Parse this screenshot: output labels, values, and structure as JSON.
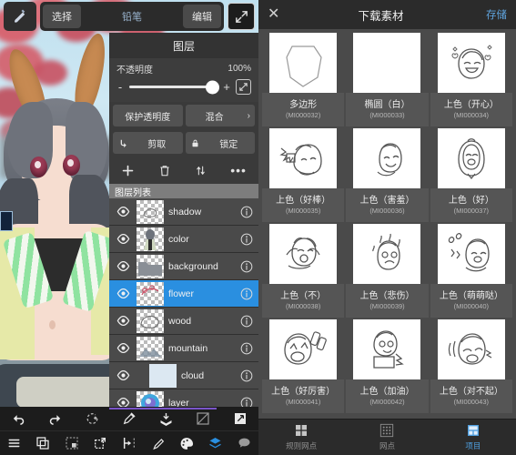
{
  "editor": {
    "toolbar": {
      "brush_icon": "brush-icon",
      "select_label": "选择",
      "tool_label": "铅笔",
      "edit_label": "编辑",
      "expand_icon": "expand-arrows-icon"
    },
    "layers_panel": {
      "title": "图层",
      "opacity_label": "不透明度",
      "opacity_value": "100%",
      "minus": "-",
      "plus": "+",
      "slider_icon": "expand-icon",
      "protect_alpha_label": "保护透明度",
      "blend_label": "混合",
      "blend_chevron": "›",
      "clip_label": "剪取",
      "clip_icon": "clip-arrow-icon",
      "lock_label": "锁定",
      "lock_icon": "lock-icon",
      "tools": [
        {
          "name": "add-layer-icon",
          "glyph": "+"
        },
        {
          "name": "delete-layer-icon",
          "glyph": "trash"
        },
        {
          "name": "reorder-layer-icon",
          "glyph": "arrows"
        },
        {
          "name": "more-options-icon",
          "glyph": "•••"
        }
      ],
      "list_header": "图层列表",
      "layers": [
        {
          "name": "shadow",
          "visible": true,
          "selected": false,
          "clipped": false
        },
        {
          "name": "color",
          "visible": true,
          "selected": false,
          "clipped": false
        },
        {
          "name": "background",
          "visible": true,
          "selected": false,
          "clipped": false
        },
        {
          "name": "flower",
          "visible": true,
          "selected": true,
          "clipped": false
        },
        {
          "name": "wood",
          "visible": true,
          "selected": false,
          "clipped": false
        },
        {
          "name": "mountain",
          "visible": true,
          "selected": false,
          "clipped": false
        },
        {
          "name": "cloud",
          "visible": true,
          "selected": false,
          "clipped": true
        },
        {
          "name": "layer",
          "visible": true,
          "selected": false,
          "clipped": false
        }
      ],
      "eye_icon": "eye-icon",
      "info_icon": "info-icon",
      "selection_color": "#2a8fe0"
    },
    "bottom_toolbar": {
      "row1": [
        {
          "name": "undo-icon"
        },
        {
          "name": "redo-icon"
        },
        {
          "name": "rotate-icon"
        },
        {
          "name": "eyedropper-icon"
        },
        {
          "name": "bucket-save-icon"
        },
        {
          "name": "gradient-icon"
        },
        {
          "name": "fill-square-icon"
        }
      ],
      "row2": [
        {
          "name": "menu-icon"
        },
        {
          "name": "copy-icon"
        },
        {
          "name": "select-region-icon"
        },
        {
          "name": "transform-icon"
        },
        {
          "name": "ruler-icon"
        },
        {
          "name": "pen-icon"
        },
        {
          "name": "palette-icon"
        },
        {
          "name": "layers-icon"
        },
        {
          "name": "speech-bubble-icon"
        }
      ]
    }
  },
  "materials": {
    "header": {
      "close_icon": "close-icon",
      "title": "下载素材",
      "save_label": "存储"
    },
    "items": [
      {
        "name": "多边形",
        "id": "(MI000032)",
        "art": "polygon"
      },
      {
        "name": "椭圆（白）",
        "id": "(MI000033)",
        "art": "blank"
      },
      {
        "name": "上色（开心）",
        "id": "(MI000034)",
        "art": "happy"
      },
      {
        "name": "上色（好棒）",
        "id": "(MI000035)",
        "art": "great"
      },
      {
        "name": "上色（害羞）",
        "id": "(MI000036)",
        "art": "shy"
      },
      {
        "name": "上色（好）",
        "id": "(MI000037)",
        "art": "good"
      },
      {
        "name": "上色（不）",
        "id": "(MI000038)",
        "art": "no"
      },
      {
        "name": "上色（悲伤）",
        "id": "(MI000039)",
        "art": "sad"
      },
      {
        "name": "上色（萌萌哒）",
        "id": "(MI000040)",
        "art": "cute"
      },
      {
        "name": "上色（好厉害）",
        "id": "(MI000041)",
        "art": "amazing"
      },
      {
        "name": "上色（加油）",
        "id": "(MI000042)",
        "art": "cheer"
      },
      {
        "name": "上色（对不起）",
        "id": "(MI000043)",
        "art": "sorry"
      }
    ],
    "tabs": [
      {
        "label": "规则网点",
        "icon": "grid-dots-icon",
        "active": false
      },
      {
        "label": "网点",
        "icon": "halftone-icon",
        "active": false
      },
      {
        "label": "项目",
        "icon": "project-icon",
        "active": true
      }
    ],
    "accent_color": "#4e9ede"
  }
}
